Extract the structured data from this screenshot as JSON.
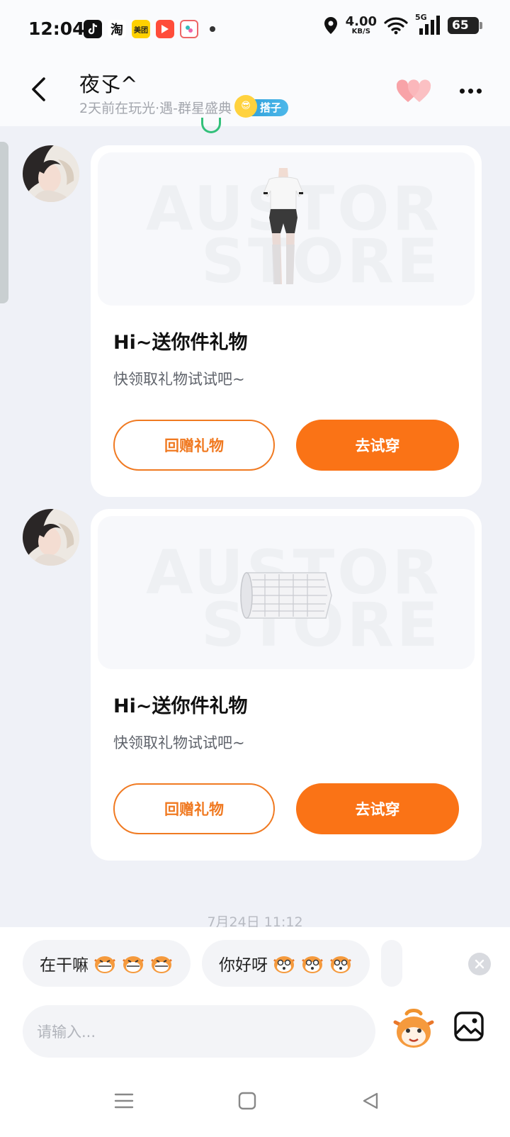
{
  "status_bar": {
    "time": "12:04",
    "apps": [
      {
        "name": "douyin",
        "label": "",
        "color": "#111111"
      },
      {
        "name": "taobao",
        "label": "淘",
        "color": "#ffffff"
      },
      {
        "name": "meituan",
        "label": "美团",
        "color": "#ffd100"
      },
      {
        "name": "video",
        "label": "",
        "color": "#ff4d3a"
      },
      {
        "name": "gallery",
        "label": "",
        "color": "#ffffff"
      }
    ],
    "net_speed": "4.00",
    "net_unit": "KB/S",
    "network": "5G",
    "battery": "65"
  },
  "header": {
    "name": "夜孓^",
    "status": "2天前在玩光·遇-群星盛典",
    "badge": "搭子"
  },
  "messages": [
    {
      "card_title": "Hi~送你件礼物",
      "card_subtitle": "快领取礼物试试吧~",
      "watermark_top": "AUSTOR",
      "watermark_bottom": "STORE",
      "item": "outfit",
      "btn_secondary": "回赠礼物",
      "btn_primary": "去试穿"
    },
    {
      "card_title": "Hi~送你件礼物",
      "card_subtitle": "快领取礼物试试吧~",
      "watermark_top": "AUSTOR",
      "watermark_bottom": "STORE",
      "item": "scroll",
      "btn_secondary": "回赠礼物",
      "btn_primary": "去试穿"
    }
  ],
  "timestamp": "7月24日 11:12",
  "quick_replies": [
    {
      "text": "在干嘛"
    },
    {
      "text": "你好呀"
    }
  ],
  "input": {
    "placeholder": "请输入..."
  },
  "colors": {
    "accent": "#fa7316",
    "badge": "#2b9bd6"
  }
}
